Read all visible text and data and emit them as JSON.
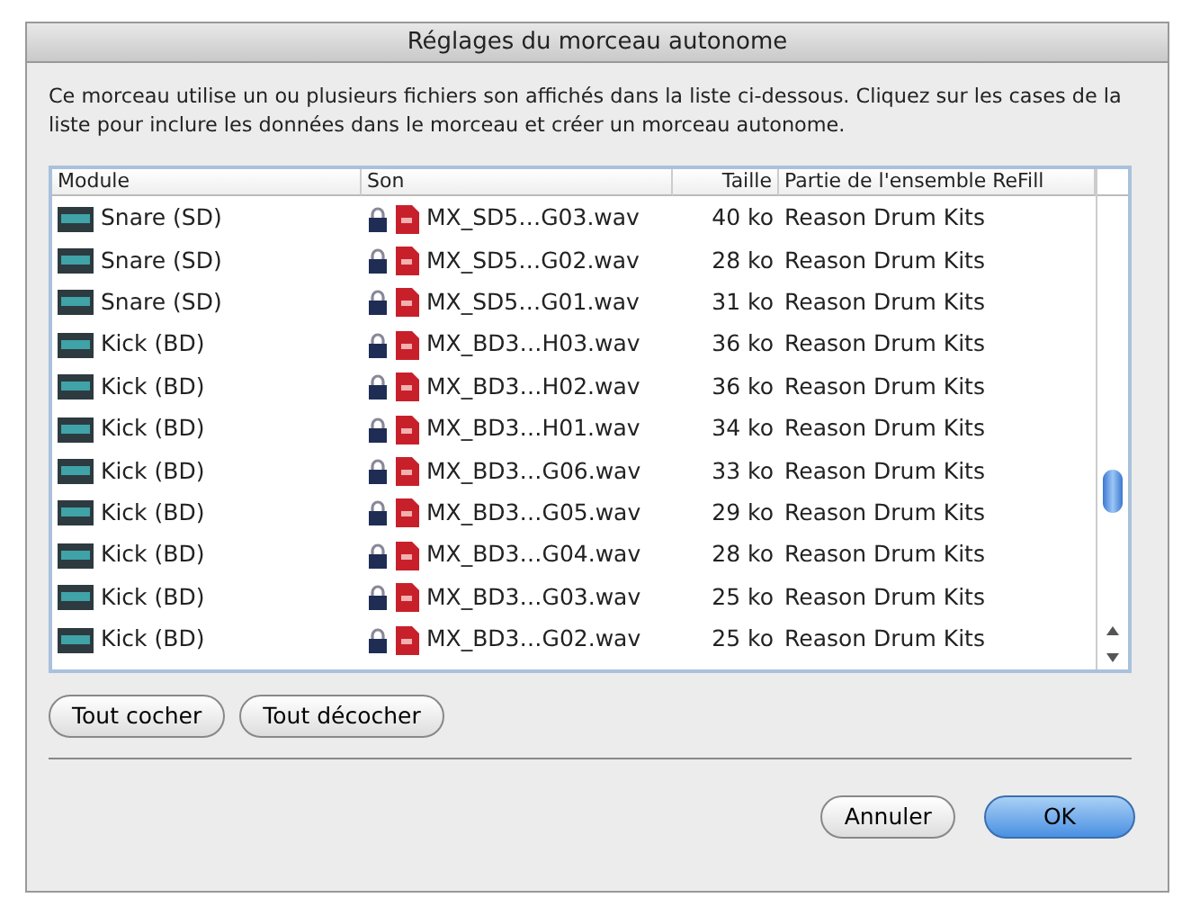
{
  "window": {
    "title": "Réglages du morceau autonome"
  },
  "description": "Ce morceau utilise un ou plusieurs fichiers son affichés dans la liste ci-dessous. Cliquez sur les cases de la liste pour inclure les données dans le morceau et créer un morceau autonome.",
  "table": {
    "columns": [
      "Module",
      "Son",
      "Taille",
      "Partie de l'ensemble ReFill"
    ],
    "rows": [
      {
        "module": "Snare (SD)",
        "sound": "MX_SD5…G03.wav",
        "size": "40 ko",
        "refill": "Reason Drum Kits",
        "locked": true
      },
      {
        "module": "Snare (SD)",
        "sound": "MX_SD5…G02.wav",
        "size": "28 ko",
        "refill": "Reason Drum Kits",
        "locked": true
      },
      {
        "module": "Snare (SD)",
        "sound": "MX_SD5…G01.wav",
        "size": "31 ko",
        "refill": "Reason Drum Kits",
        "locked": true
      },
      {
        "module": "Kick (BD)",
        "sound": "MX_BD3…H03.wav",
        "size": "36 ko",
        "refill": "Reason Drum Kits",
        "locked": true
      },
      {
        "module": "Kick (BD)",
        "sound": "MX_BD3…H02.wav",
        "size": "36 ko",
        "refill": "Reason Drum Kits",
        "locked": true
      },
      {
        "module": "Kick (BD)",
        "sound": "MX_BD3…H01.wav",
        "size": "34 ko",
        "refill": "Reason Drum Kits",
        "locked": true
      },
      {
        "module": "Kick (BD)",
        "sound": "MX_BD3…G06.wav",
        "size": "33 ko",
        "refill": "Reason Drum Kits",
        "locked": true
      },
      {
        "module": "Kick (BD)",
        "sound": "MX_BD3…G05.wav",
        "size": "29 ko",
        "refill": "Reason Drum Kits",
        "locked": true
      },
      {
        "module": "Kick (BD)",
        "sound": "MX_BD3…G04.wav",
        "size": "28 ko",
        "refill": "Reason Drum Kits",
        "locked": true
      },
      {
        "module": "Kick (BD)",
        "sound": "MX_BD3…G03.wav",
        "size": "25 ko",
        "refill": "Reason Drum Kits",
        "locked": true
      },
      {
        "module": "Kick (BD)",
        "sound": "MX_BD3…G02.wav",
        "size": "25 ko",
        "refill": "Reason Drum Kits",
        "locked": true
      }
    ]
  },
  "list_buttons": [
    "Tout cocher",
    "Tout décocher"
  ],
  "dialog_buttons": [
    {
      "label": "Annuler",
      "kind": "normal"
    },
    {
      "label": "OK",
      "kind": "default"
    }
  ]
}
